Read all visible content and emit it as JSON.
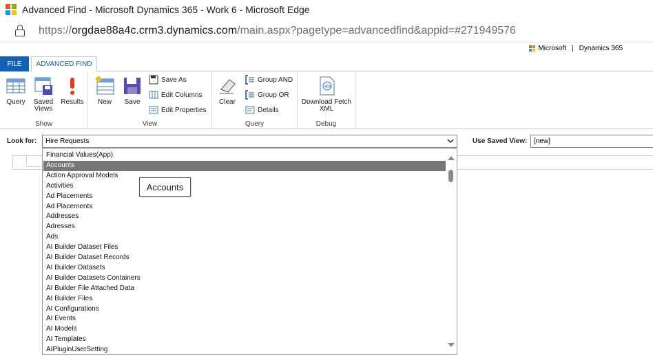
{
  "browser": {
    "window_title": "Advanced Find - Microsoft Dynamics 365 - Work 6 - Microsoft Edge",
    "url_prefix": "https://",
    "url_host": "orgdae88a4c.crm3.dynamics.com",
    "url_path": "/main.aspx?pagetype=advancedfind&appid=#271949576"
  },
  "header": {
    "microsoft": "Microsoft",
    "separator": "|",
    "product": "Dynamics 365"
  },
  "tabs": {
    "file": "FILE",
    "advanced_find": "ADVANCED FIND"
  },
  "ribbon": {
    "show": {
      "label": "Show",
      "query": "Query",
      "saved_views_1": "Saved",
      "saved_views_2": "Views",
      "results": "Results"
    },
    "view": {
      "label": "View",
      "new": "New",
      "save": "Save",
      "save_as": "Save As",
      "edit_columns": "Edit Columns",
      "edit_properties": "Edit Properties"
    },
    "query": {
      "label": "Query",
      "clear": "Clear",
      "group_and": "Group AND",
      "group_or": "Group OR",
      "details": "Details"
    },
    "debug": {
      "label": "Debug",
      "download_1": "Download Fetch",
      "download_2": "XML"
    }
  },
  "lookfor": {
    "label": "Look for:",
    "value": "Hire Requests",
    "saved_view_label": "Use Saved View:",
    "saved_view_value": "[new]"
  },
  "dropdown": {
    "items": [
      "Financial Values(App)",
      "Accounts",
      "Action Approval Models",
      "Activities",
      "Ad Placements",
      "Ad Placements",
      "Addresses",
      "Adresses",
      "Ads",
      "AI Builder Dataset Files",
      "AI Builder Dataset Records",
      "AI Builder Datasets",
      "AI Builder Datasets Containers",
      "AI Builder File Attached Data",
      "AI Builder Files",
      "AI Configurations",
      "AI Events",
      "AI Models",
      "AI Templates",
      "AIPluginUserSetting"
    ],
    "selected_index": 1,
    "tooltip": "Accounts"
  },
  "colors": {
    "file_tab": "#1160b7",
    "selected_row": "#777777"
  }
}
